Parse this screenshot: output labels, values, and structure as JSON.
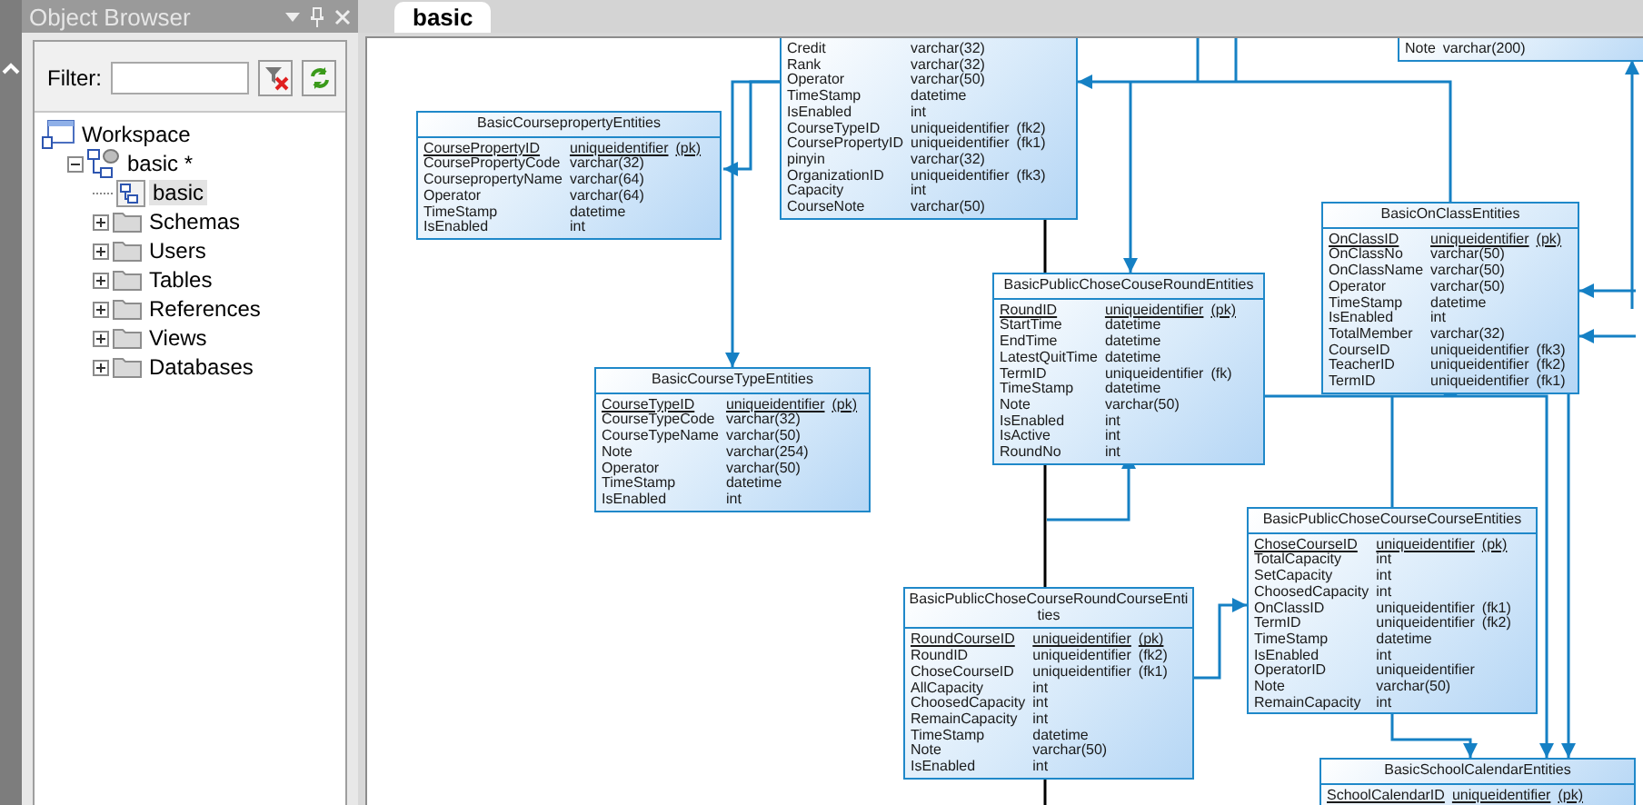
{
  "object_browser": {
    "title": "Object Browser",
    "filter_label": "Filter:",
    "tree": [
      {
        "label": "Workspace",
        "kind": "workspace",
        "children": [
          {
            "label": "basic *",
            "kind": "model",
            "expanded": true,
            "children": [
              {
                "label": "basic",
                "kind": "diagram",
                "selected": true
              },
              {
                "label": "Schemas",
                "kind": "folder",
                "expanded": false
              },
              {
                "label": "Users",
                "kind": "folder",
                "expanded": false
              },
              {
                "label": "Tables",
                "kind": "folder",
                "expanded": false
              },
              {
                "label": "References",
                "kind": "folder",
                "expanded": false
              },
              {
                "label": "Views",
                "kind": "folder",
                "expanded": false
              },
              {
                "label": "Databases",
                "kind": "folder",
                "expanded": false
              }
            ]
          }
        ]
      }
    ]
  },
  "tabs": [
    {
      "label": "basic",
      "selected": true
    }
  ],
  "entities": [
    {
      "columns": [
        {
          "name": "Credit",
          "type": "varchar(32)",
          "pk": false
        },
        {
          "name": "Rank",
          "type": "varchar(32)",
          "pk": false
        },
        {
          "name": "Operator",
          "type": "varchar(50)",
          "pk": false
        },
        {
          "name": "TimeStamp",
          "type": "datetime",
          "pk": false
        },
        {
          "name": "IsEnabled",
          "type": "int",
          "pk": false
        },
        {
          "name": "CourseTypeID",
          "type": "uniqueidentifier",
          "key": "(fk2)",
          "pk": false
        },
        {
          "name": "CoursePropertyID",
          "type": "uniqueidentifier",
          "key": "(fk1)",
          "pk": false
        },
        {
          "name": "pinyin",
          "type": "varchar(32)",
          "pk": false
        },
        {
          "name": "OrganizationID",
          "type": "uniqueidentifier",
          "key": "(fk3)",
          "pk": false
        },
        {
          "name": "Capacity",
          "type": "int",
          "pk": false
        },
        {
          "name": "CourseNote",
          "type": "varchar(50)",
          "pk": false
        }
      ]
    },
    {
      "columns": [
        {
          "name": "Note",
          "type": "varchar(200)",
          "pk": false
        }
      ]
    },
    {
      "title": "BasicCoursepropertyEntities",
      "columns": [
        {
          "name": "CoursePropertyID",
          "type": "uniqueidentifier",
          "key": "(pk)",
          "pk": true
        },
        {
          "name": "CoursePropertyCode",
          "type": "varchar(32)",
          "pk": false
        },
        {
          "name": "CoursepropertyName",
          "type": "varchar(64)",
          "pk": false
        },
        {
          "name": "Operator",
          "type": "varchar(64)",
          "pk": false
        },
        {
          "name": "TimeStamp",
          "type": "datetime",
          "pk": false
        },
        {
          "name": "IsEnabled",
          "type": "int",
          "pk": false
        }
      ]
    },
    {
      "title": "BasicCourseTypeEntities",
      "columns": [
        {
          "name": "CourseTypeID",
          "type": "uniqueidentifier",
          "key": "(pk)",
          "pk": true
        },
        {
          "name": "CourseTypeCode",
          "type": "varchar(32)",
          "pk": false
        },
        {
          "name": "CourseTypeName",
          "type": "varchar(50)",
          "pk": false
        },
        {
          "name": "Note",
          "type": "varchar(254)",
          "pk": false
        },
        {
          "name": "Operator",
          "type": "varchar(50)",
          "pk": false
        },
        {
          "name": "TimeStamp",
          "type": "datetime",
          "pk": false
        },
        {
          "name": "IsEnabled",
          "type": "int",
          "pk": false
        }
      ]
    },
    {
      "title": "BasicPublicChoseCouseRoundEntities",
      "columns": [
        {
          "name": "RoundID",
          "type": "uniqueidentifier",
          "key": "(pk)",
          "pk": true
        },
        {
          "name": "StartTime",
          "type": "datetime",
          "pk": false
        },
        {
          "name": "EndTime",
          "type": "datetime",
          "pk": false
        },
        {
          "name": "LatestQuitTime",
          "type": "datetime",
          "pk": false
        },
        {
          "name": "TermID",
          "type": "uniqueidentifier",
          "key": "(fk)",
          "pk": false
        },
        {
          "name": "TimeStamp",
          "type": "datetime",
          "pk": false
        },
        {
          "name": "Note",
          "type": "varchar(50)",
          "pk": false
        },
        {
          "name": "IsEnabled",
          "type": "int",
          "pk": false
        },
        {
          "name": "IsActive",
          "type": "int",
          "pk": false
        },
        {
          "name": "RoundNo",
          "type": "int",
          "pk": false
        }
      ]
    },
    {
      "title": "BasicOnClassEntities",
      "columns": [
        {
          "name": "OnClassID",
          "type": "uniqueidentifier",
          "key": "(pk)",
          "pk": true
        },
        {
          "name": "OnClassNo",
          "type": "varchar(50)",
          "pk": false
        },
        {
          "name": "OnClassName",
          "type": "varchar(50)",
          "pk": false
        },
        {
          "name": "Operator",
          "type": "varchar(50)",
          "pk": false
        },
        {
          "name": "TimeStamp",
          "type": "datetime",
          "pk": false
        },
        {
          "name": "IsEnabled",
          "type": "int",
          "pk": false
        },
        {
          "name": "TotalMember",
          "type": "varchar(32)",
          "pk": false
        },
        {
          "name": "CourseID",
          "type": "uniqueidentifier",
          "key": "(fk3)",
          "pk": false
        },
        {
          "name": "TeacherID",
          "type": "uniqueidentifier",
          "key": "(fk2)",
          "pk": false
        },
        {
          "name": "TermID",
          "type": "uniqueidentifier",
          "key": "(fk1)",
          "pk": false
        }
      ]
    },
    {
      "title": "BasicPublicChoseCourseRoundCourseEntities",
      "columns": [
        {
          "name": "RoundCourseID",
          "type": "uniqueidentifier",
          "key": "(pk)",
          "pk": true
        },
        {
          "name": "RoundID",
          "type": "uniqueidentifier",
          "key": "(fk2)",
          "pk": false
        },
        {
          "name": "ChoseCourseID",
          "type": "uniqueidentifier",
          "key": "(fk1)",
          "pk": false
        },
        {
          "name": "AllCapacity",
          "type": "int",
          "pk": false
        },
        {
          "name": "ChoosedCapacity",
          "type": "int",
          "pk": false
        },
        {
          "name": "RemainCapacity",
          "type": "int",
          "pk": false
        },
        {
          "name": "TimeStamp",
          "type": "datetime",
          "pk": false
        },
        {
          "name": "Note",
          "type": "varchar(50)",
          "pk": false
        },
        {
          "name": "IsEnabled",
          "type": "int",
          "pk": false
        }
      ]
    },
    {
      "title": "BasicPublicChoseCourseCourseEntities",
      "columns": [
        {
          "name": "ChoseCourseID",
          "type": "uniqueidentifier",
          "key": "(pk)",
          "pk": true
        },
        {
          "name": "TotalCapacity",
          "type": "int",
          "pk": false
        },
        {
          "name": "SetCapacity",
          "type": "int",
          "pk": false
        },
        {
          "name": "ChoosedCapacity",
          "type": "int",
          "pk": false
        },
        {
          "name": "OnClassID",
          "type": "uniqueidentifier",
          "key": "(fk1)",
          "pk": false
        },
        {
          "name": "TermID",
          "type": "uniqueidentifier",
          "key": "(fk2)",
          "pk": false
        },
        {
          "name": "TimeStamp",
          "type": "datetime",
          "pk": false
        },
        {
          "name": "IsEnabled",
          "type": "int",
          "pk": false
        },
        {
          "name": "OperatorID",
          "type": "uniqueidentifier",
          "pk": false
        },
        {
          "name": "Note",
          "type": "varchar(50)",
          "pk": false
        },
        {
          "name": "RemainCapacity",
          "type": "int",
          "pk": false
        }
      ]
    },
    {
      "title": "BasicSchoolCalendarEntities",
      "columns": [
        {
          "name": "SchoolCalendarID",
          "type": "uniqueidentifier",
          "key": "(pk)",
          "pk": true
        }
      ]
    }
  ]
}
